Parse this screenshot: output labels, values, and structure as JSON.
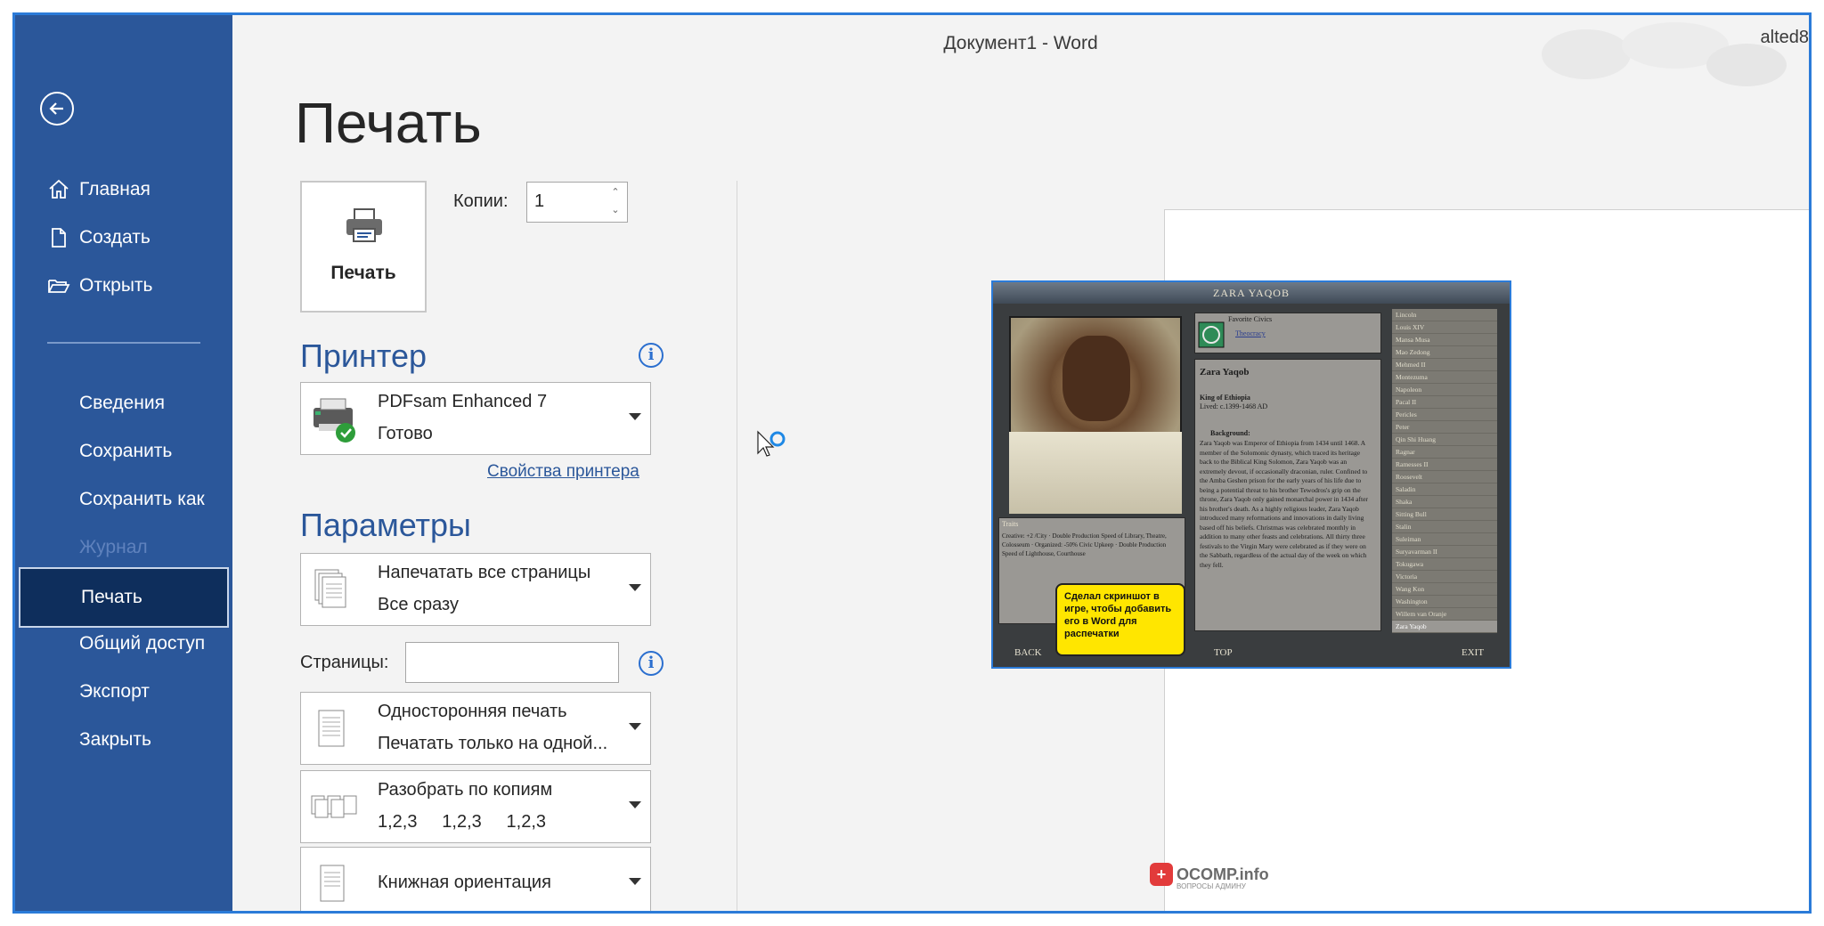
{
  "window": {
    "doc_title": "Документ1  -  Word",
    "user": "alted8"
  },
  "sidebar": {
    "back_icon": "back-arrow-icon",
    "items": [
      {
        "label": "Главная",
        "icon": "home-icon",
        "state": "normal"
      },
      {
        "label": "Создать",
        "icon": "new-document-icon",
        "state": "normal"
      },
      {
        "label": "Открыть",
        "icon": "open-folder-icon",
        "state": "normal"
      },
      {
        "label": "Сведения",
        "state": "normal"
      },
      {
        "label": "Сохранить",
        "state": "normal"
      },
      {
        "label": "Сохранить как",
        "state": "normal"
      },
      {
        "label": "Журнал",
        "state": "disabled"
      },
      {
        "label": "Печать",
        "state": "active"
      },
      {
        "label": "Общий доступ",
        "state": "normal"
      },
      {
        "label": "Экспорт",
        "state": "normal"
      },
      {
        "label": "Закрыть",
        "state": "normal"
      }
    ]
  },
  "print": {
    "title": "Печать",
    "print_button_label": "Печать",
    "copies_label": "Копии:",
    "copies_value": "1",
    "printer_heading": "Принтер",
    "printer_name": "PDFsam Enhanced 7",
    "printer_status": "Готово",
    "printer_properties_link": "Свойства принтера",
    "settings_heading": "Параметры",
    "range_line1": "Напечатать все страницы",
    "range_line2": "Все сразу",
    "pages_label": "Страницы:",
    "pages_value": "",
    "sides_line1": "Односторонняя печать",
    "sides_line2": "Печатать только на одной...",
    "collate_line1": "Разобрать по копиям",
    "collate_line2": "1,2,3     1,2,3     1,2,3",
    "orientation_line1": "Книжная ориентация"
  },
  "preview": {
    "game_title": "ZARA YAQOB",
    "favorite_civics_label": "Favorite Civics",
    "favorite_civic": "Theocracy",
    "leader_name": "Zara Yaqob",
    "leader_role": "King of Ethiopia",
    "leader_lived": "Lived: c.1399-1468 AD",
    "background_label": "Background:",
    "background_text": "Zara Yaqob was Emperor of Ethiopia from 1434 until 1468. A member of the Solomonic dynasty, which traced its heritage back to the Biblical King Solomon, Zara Yaqob was an extremely devout, if occasionally draconian, ruler. Confined to the Amba Geshen prison for the early years of his life due to being a potential threat to his brother Tewodros's grip on the throne, Zara Yaqob only gained monarchal power in 1434 after his brother's death. As a highly religious leader, Zara Yaqob introduced many reformations and innovations in daily living based off his beliefs. Christmas was celebrated monthly in addition to many other feasts and celebrations. All thirty three festivals to the Virgin Mary were celebrated as if they were on the Sabbath, regardless of the actual day of the week on which they fell.",
    "traits_label": "Traits",
    "traits_text": "Creative: +2 /City · Double Production Speed of Library, Theatre, Colosseum · Organized: -50% Civic Upkeep · Double Production Speed of Lighthouse, Courthouse",
    "leaders": [
      "Lincoln",
      "Louis XIV",
      "Mansa Musa",
      "Mao Zedong",
      "Mehmed II",
      "Montezuma",
      "Napoleon",
      "Pacal II",
      "Pericles",
      "Peter",
      "Qin Shi Huang",
      "Ragnar",
      "Ramesses II",
      "Roosevelt",
      "Saladin",
      "Shaka",
      "Sitting Bull",
      "Stalin",
      "Suleiman",
      "Suryavarman II",
      "Tokugawa",
      "Victoria",
      "Wang Kon",
      "Washington",
      "Willem van Oranje",
      "Zara Yaqob"
    ],
    "nav_back": "BACK",
    "nav_top": "TOP",
    "nav_exit": "EXIT",
    "callout": "Сделал скриншот в игре, чтобы добавить его в Word для распечатки",
    "watermark_badge": "+",
    "watermark": "OCOMP.info",
    "watermark_sub": "ВОПРОСЫ АДМИНУ"
  }
}
